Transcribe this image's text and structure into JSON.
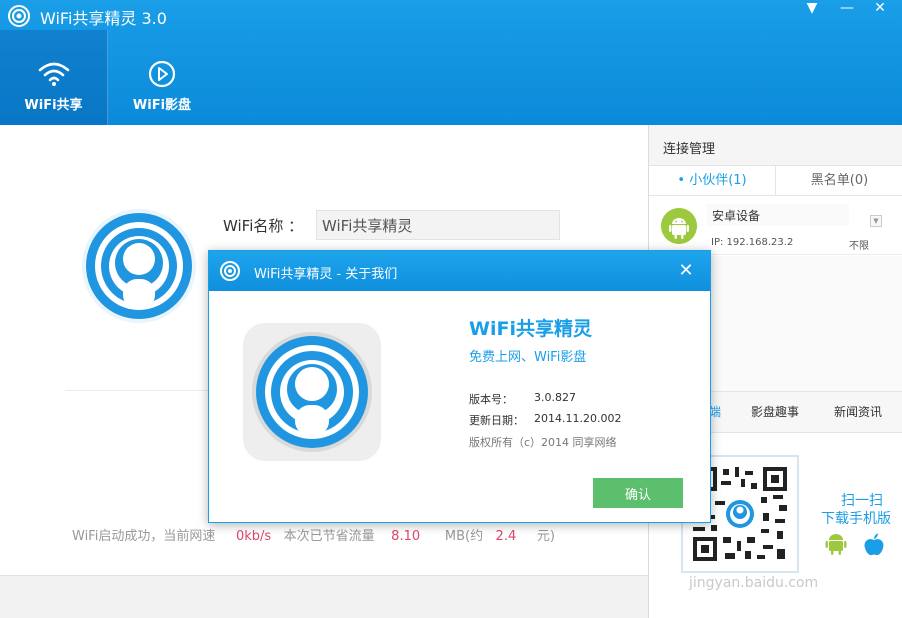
{
  "app": {
    "title": "WiFi共享精灵 3.0",
    "accent": "#1a9ee8"
  },
  "window_controls": {
    "menu": "▼",
    "minimize": "—",
    "close": "✕"
  },
  "nav": {
    "tabs": [
      {
        "label": "WiFi共享",
        "icon": "wifi-icon",
        "active": true
      },
      {
        "label": "WiFi影盘",
        "icon": "play-icon",
        "active": false
      }
    ]
  },
  "main": {
    "wifi_name_label": "WiFi名称 ：",
    "wifi_name_value": "WiFi共享精灵",
    "status": {
      "prefix": "WiFi启动成功，当前网速",
      "speed": "0kb/s",
      "saved_label": "本次已节省流量",
      "saved": "8.10",
      "unit": "MB(约",
      "money": "2.4",
      "suffix": "元)"
    }
  },
  "right_panel": {
    "title": "连接管理",
    "tabs": [
      {
        "label": "• 小伙伴(1)",
        "active": true
      },
      {
        "label": "黑名单(0)",
        "active": false
      }
    ],
    "devices": [
      {
        "name": "安卓设备",
        "ip": "IP: 192.168.23.2",
        "limit": "不限",
        "dropdown": "▼"
      }
    ],
    "lower_tabs": [
      "端",
      "影盘趣事",
      "新闻资讯"
    ],
    "scan_line1": "扫一扫",
    "scan_line2": "下载手机版",
    "watermark": "jingyan.baidu.com"
  },
  "dialog": {
    "title": "WiFi共享精灵 - 关于我们",
    "close": "✕",
    "app_name": "WiFi共享精灵",
    "tagline": "免费上网、WiFi影盘",
    "version_label": "版本号：",
    "version": "3.0.827",
    "date_label": "更新日期：",
    "date": "2014.11.20.002",
    "copyright": "版权所有（c）2014 同享网络",
    "confirm": "确认"
  }
}
